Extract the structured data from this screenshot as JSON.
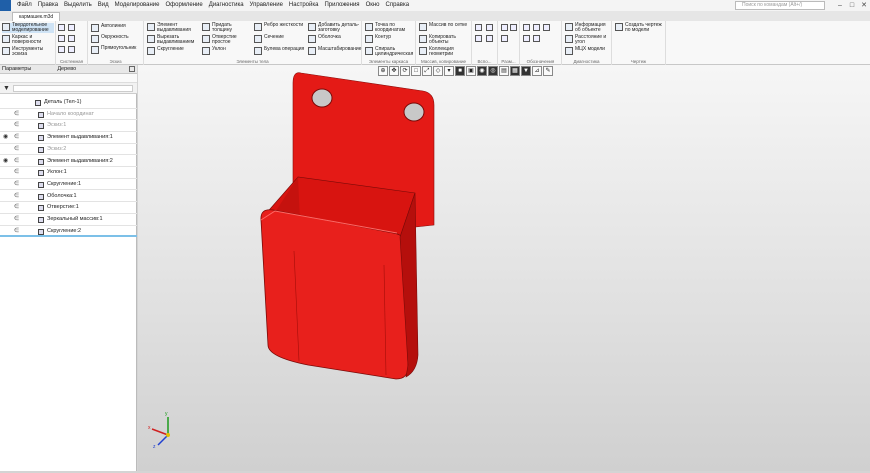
{
  "menubar": {
    "items": [
      "Файл",
      "Правка",
      "Выделить",
      "Вид",
      "Моделирование",
      "Оформление",
      "Диагностика",
      "Управление",
      "Настройка",
      "Приложения",
      "Окно",
      "Справка"
    ],
    "search_placeholder": "Поиск по командам (Alt+/)"
  },
  "tabs": {
    "document": "кармашек.m3d"
  },
  "ribbon": {
    "left_modes": [
      "Твердотельное моделирование",
      "Каркас и поверхности",
      "Инструменты эскиза"
    ],
    "sketch_label": "Системная",
    "eskiz_label": "Эскиз",
    "eskiz_buttons": [
      "Автолиния",
      "Окружность",
      "Прямоугольник"
    ],
    "body_buttons": [
      "Элемент выдавливания",
      "Вырезать выдавливанием",
      "Скругление",
      "Придать толщину",
      "Отверстие простое",
      "Уклон",
      "Ребро жесткости",
      "Сечение",
      "Булева операция",
      "Добавить деталь-заготовку",
      "Оболочка",
      "Масштабирование"
    ],
    "body_label": "Элементы тела",
    "frame_buttons": [
      "Точка по координатам",
      "Контур",
      "Спираль цилиндрическая"
    ],
    "frame_label": "Элементы каркаса",
    "copy_buttons": [
      "Массив по сетке",
      "Копировать объекты",
      "Коллекция геометрии"
    ],
    "copy_label": "Массив, копирование",
    "small_labels": [
      "Вспо...",
      "Разм...",
      "Обозначения"
    ],
    "diag_buttons": [
      "Информация об объекте",
      "Расстояние и угол",
      "МЦХ модели"
    ],
    "diag_label": "Диагностика",
    "drawing_button": "Создать чертеж по модели",
    "drawing_label": "Чертеж"
  },
  "panel": {
    "tabs": [
      "Параметры",
      "Дерево"
    ],
    "tree": [
      {
        "text": "Деталь (Тел-1)",
        "indent": 0,
        "eye": false,
        "grey": false
      },
      {
        "text": "Начало координат",
        "indent": 1,
        "eye": false,
        "grey": true
      },
      {
        "text": "Эскиз:1",
        "indent": 1,
        "eye": false,
        "grey": true
      },
      {
        "text": "Элемент выдавливания:1",
        "indent": 1,
        "eye": true,
        "grey": false
      },
      {
        "text": "Эскиз:2",
        "indent": 1,
        "eye": false,
        "grey": true
      },
      {
        "text": "Элемент выдавливания:2",
        "indent": 1,
        "eye": true,
        "grey": false
      },
      {
        "text": "Уклон:1",
        "indent": 1,
        "eye": false,
        "grey": false
      },
      {
        "text": "Скругление:1",
        "indent": 1,
        "eye": false,
        "grey": false
      },
      {
        "text": "Оболочка:1",
        "indent": 1,
        "eye": false,
        "grey": false
      },
      {
        "text": "Отверстие:1",
        "indent": 1,
        "eye": false,
        "grey": false
      },
      {
        "text": "Зеркальный массив:1",
        "indent": 1,
        "eye": false,
        "grey": false
      },
      {
        "text": "Скругление:2",
        "indent": 1,
        "eye": false,
        "grey": false
      }
    ]
  },
  "colors": {
    "model": "#e8201c",
    "accent": "#1f5fa8",
    "selection": "#7cc0e8"
  },
  "axis_labels": {
    "x": "x",
    "y": "y",
    "z": "z"
  }
}
